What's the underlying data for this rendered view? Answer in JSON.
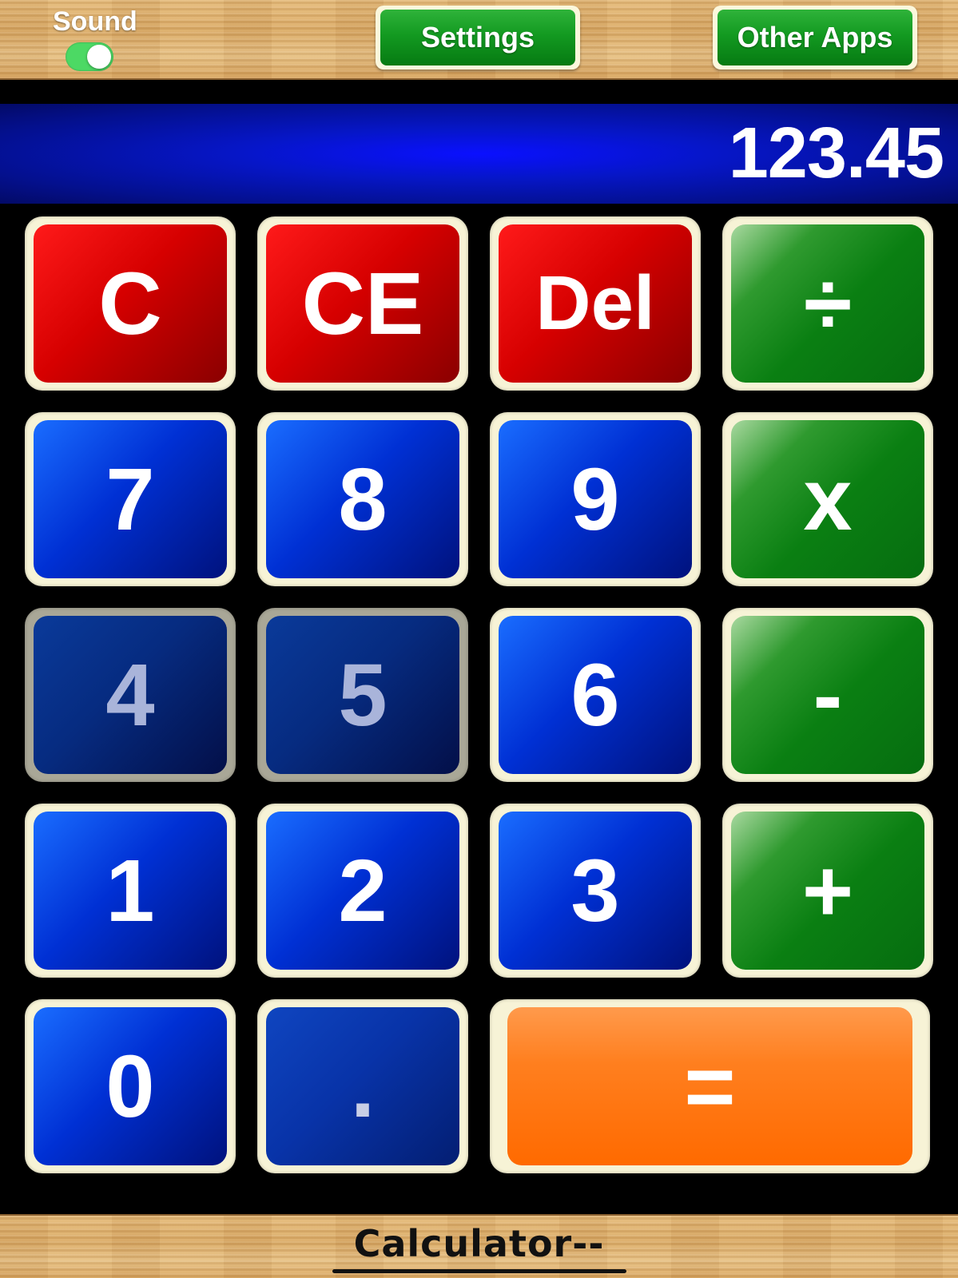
{
  "top_bar": {
    "sound_label": "Sound",
    "sound_on": true,
    "settings_label": "Settings",
    "other_apps_label": "Other Apps"
  },
  "display": {
    "value": "123.45"
  },
  "keys": [
    {
      "label": "C",
      "color": "red"
    },
    {
      "label": "CE",
      "color": "red"
    },
    {
      "label": "Del",
      "color": "red"
    },
    {
      "label": "÷",
      "color": "green"
    },
    {
      "label": "7",
      "color": "blue"
    },
    {
      "label": "8",
      "color": "blue"
    },
    {
      "label": "9",
      "color": "blue"
    },
    {
      "label": "x",
      "color": "green"
    },
    {
      "label": "4",
      "color": "blue"
    },
    {
      "label": "5",
      "color": "blue"
    },
    {
      "label": "6",
      "color": "blue"
    },
    {
      "label": "-",
      "color": "green"
    },
    {
      "label": "1",
      "color": "blue"
    },
    {
      "label": "2",
      "color": "blue"
    },
    {
      "label": "3",
      "color": "blue"
    },
    {
      "label": "+",
      "color": "green"
    },
    {
      "label": "0",
      "color": "blue"
    },
    {
      "label": ".",
      "color": "blue"
    },
    {
      "label": "=",
      "color": "orange"
    }
  ],
  "bottom_bar": {
    "title": "Calculator--"
  },
  "colors": {
    "display_blue": "#0a10ff",
    "key_red": "#d60000",
    "key_blue": "#0030d4",
    "key_green": "#0a7f12",
    "key_orange": "#ff6a00",
    "toggle_green": "#4cd964"
  }
}
